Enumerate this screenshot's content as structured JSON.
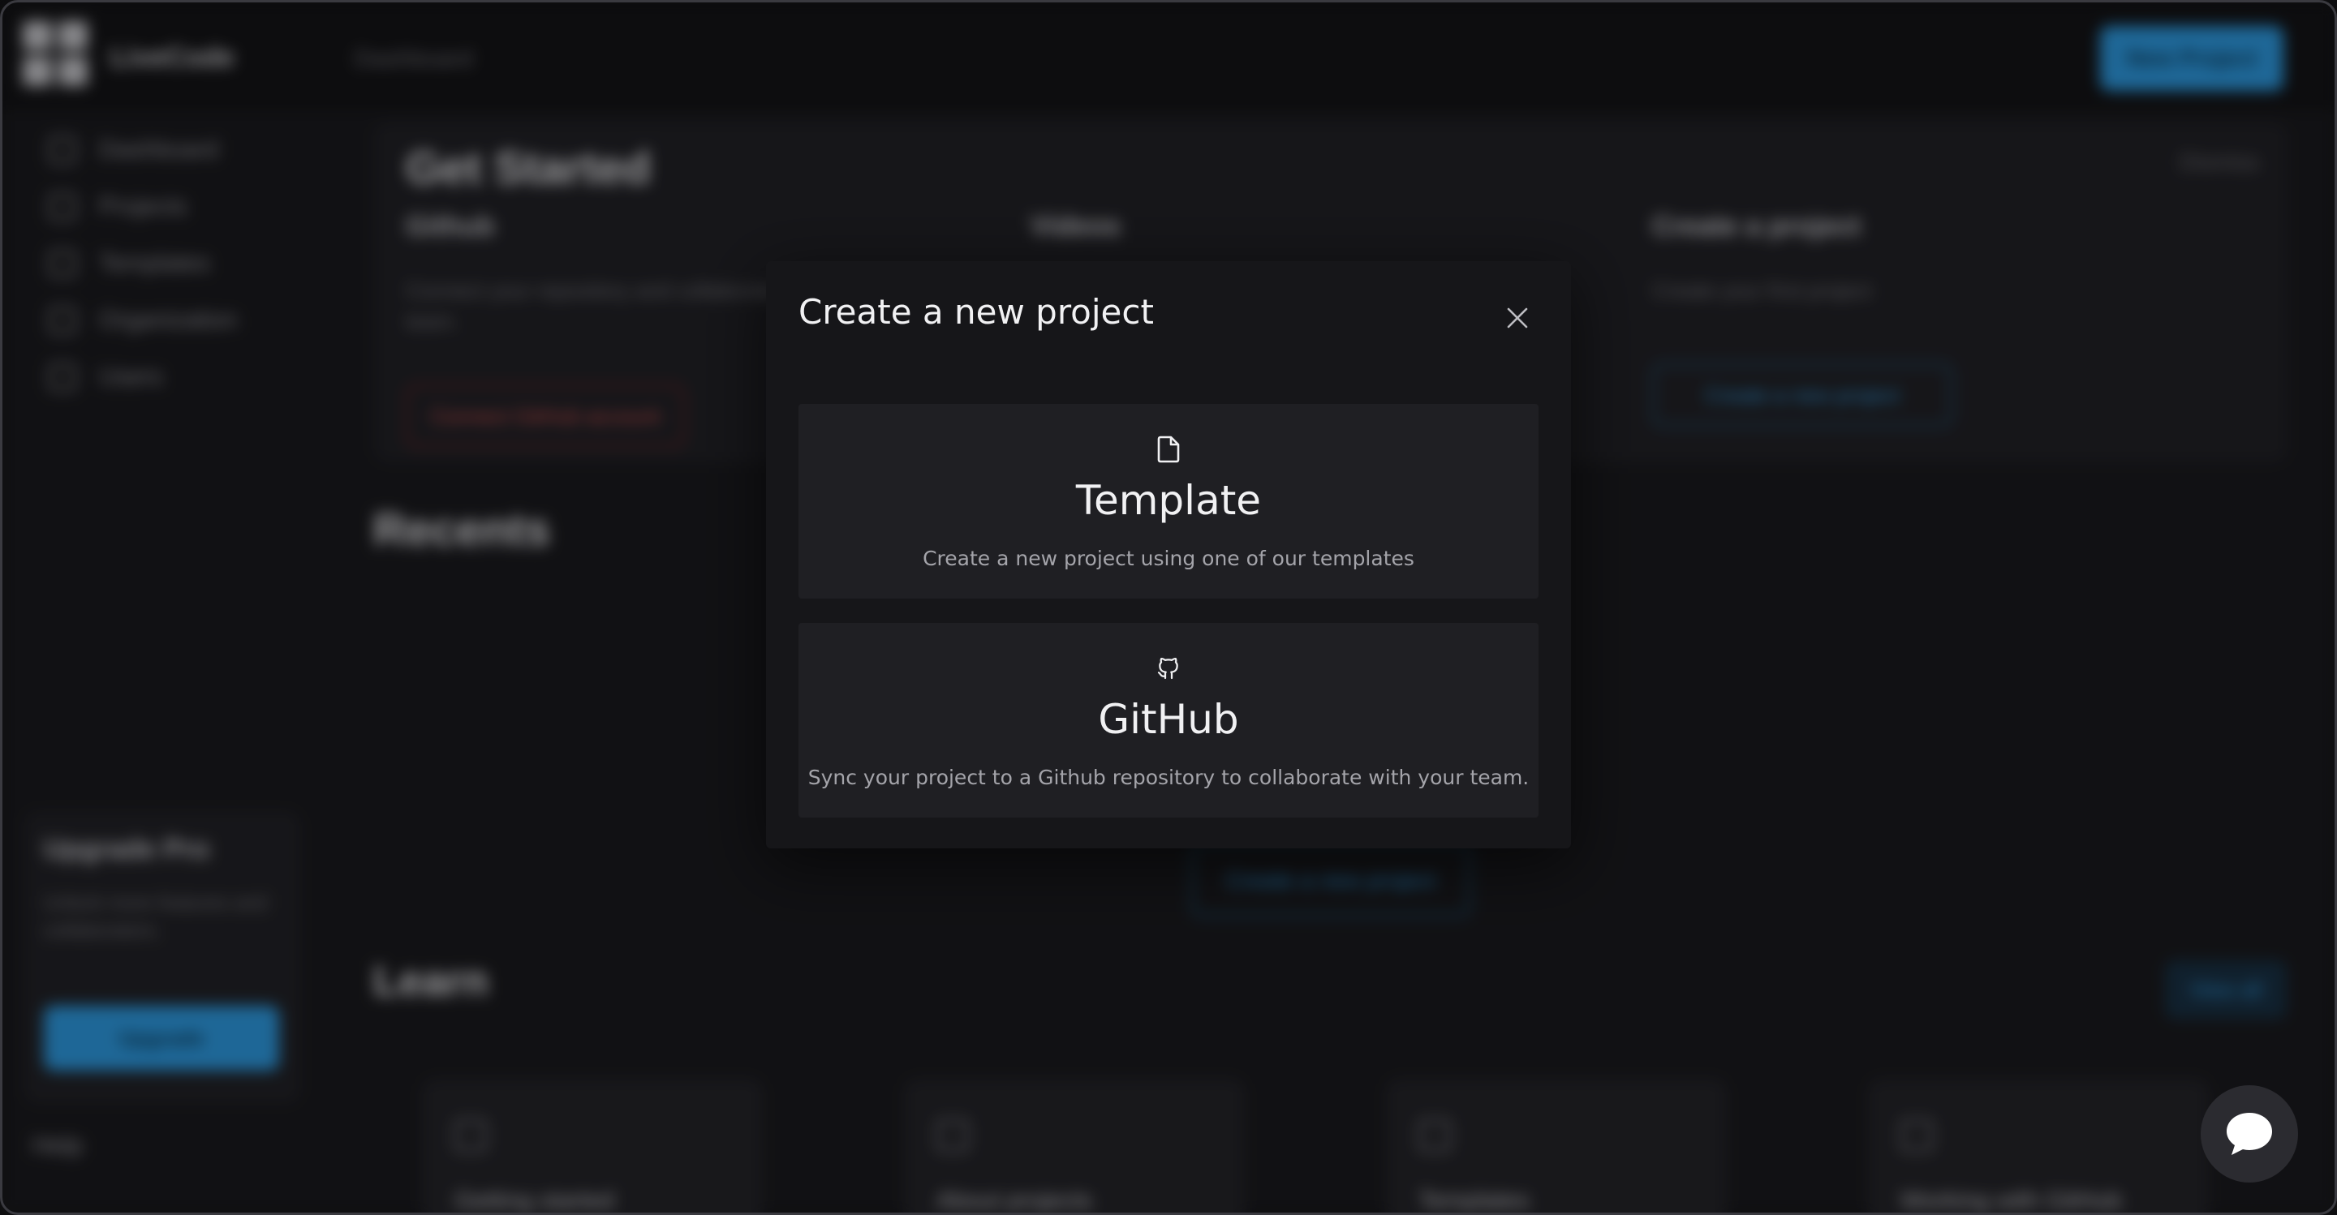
{
  "background": {
    "app_name": "LiveCode",
    "breadcrumb": "Dashboard",
    "new_project_label": "New Project",
    "sidebar": {
      "items": [
        {
          "label": "Dashboard",
          "icon": "dashboard-icon"
        },
        {
          "label": "Projects",
          "icon": "folder-icon"
        },
        {
          "label": "Templates",
          "icon": "template-icon"
        },
        {
          "label": "Organization",
          "icon": "org-icon"
        },
        {
          "label": "Users",
          "icon": "users-icon"
        }
      ],
      "upgrade_title": "Upgrade Pro",
      "upgrade_text": "Unlock more features and collaborators.",
      "upgrade_button": "Upgrade",
      "help_label": "Help"
    },
    "get_started": {
      "title": "Get Started",
      "dismiss_label": "Dismiss",
      "columns": [
        {
          "title": "Github",
          "text": "Connect your repository and collaborate on code with the team.",
          "button": "Connect GitHub account"
        },
        {
          "title": "Videos",
          "text": "",
          "button": ""
        },
        {
          "title": "Create a project",
          "text": "Create your first project",
          "button": "Create a new project"
        }
      ]
    },
    "recents_title": "Recents",
    "recents_button": "Create a new project",
    "learn_title": "Learn",
    "learn_view_all": "View all",
    "learn_cards": [
      "Getting started",
      "About projects",
      "Templates",
      "Working with GitHub"
    ]
  },
  "modal": {
    "title": "Create a new project",
    "close_icon": "close-icon",
    "options": [
      {
        "icon": "file-icon",
        "title": "Template",
        "description": "Create a new project using one of our templates"
      },
      {
        "icon": "github-icon",
        "title": "GitHub",
        "description": "Sync your project to a Github repository to collaborate with your team."
      }
    ]
  },
  "chat_widget": {
    "icon": "chat-bubble-icon"
  },
  "colors": {
    "accent": "#2f9fe8",
    "modal_bg": "#161619",
    "card_bg": "#1f1f23"
  }
}
